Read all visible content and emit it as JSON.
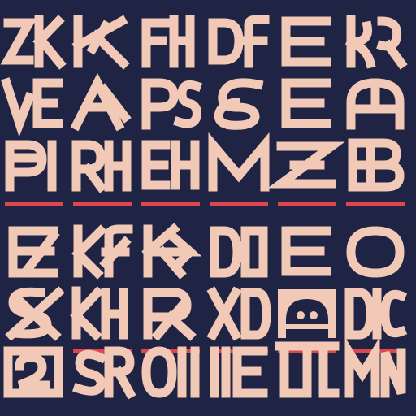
{
  "colors": {
    "background": "#1f2444",
    "glyph": "#f2c9b6",
    "rule": "#e0444d",
    "badge": "#f2c9b6",
    "badge_dark": "#1f2444"
  },
  "rows": [
    {
      "cells": [
        {
          "name": "glyph-z-k",
          "shape": "ZK"
        },
        {
          "name": "glyph-k-slash",
          "shape": "K2"
        },
        {
          "name": "glyph-f-bars",
          "shape": "FH"
        },
        {
          "name": "glyph-d-f",
          "shape": "DF"
        },
        {
          "name": "glyph-e",
          "shape": "E"
        },
        {
          "name": "glyph-k-curl",
          "shape": "KC"
        }
      ],
      "rule": false
    },
    {
      "cells": [
        {
          "name": "glyph-v-e",
          "shape": "VE"
        },
        {
          "name": "glyph-a-slash",
          "shape": "A2"
        },
        {
          "name": "glyph-p-s",
          "shape": "PS"
        },
        {
          "name": "glyph-s-loop",
          "shape": "SL"
        },
        {
          "name": "glyph-e-wide",
          "shape": "E"
        },
        {
          "name": "glyph-a-arch",
          "shape": "AH"
        }
      ],
      "rule": false
    },
    {
      "cells": [
        {
          "name": "glyph-p-i",
          "shape": "PI"
        },
        {
          "name": "glyph-r-h",
          "shape": "RH"
        },
        {
          "name": "glyph-e-split",
          "shape": "EH"
        },
        {
          "name": "glyph-m",
          "shape": "M"
        },
        {
          "name": "glyph-z-m",
          "shape": "ZM"
        },
        {
          "name": "glyph-b",
          "shape": "B"
        }
      ],
      "rule": true
    },
    {
      "cells": [
        {
          "name": "glyph-e-slash",
          "shape": "ES"
        },
        {
          "name": "glyph-k-f",
          "shape": "KF"
        },
        {
          "name": "glyph-k-arrow",
          "shape": "KA"
        },
        {
          "name": "glyph-d-o",
          "shape": "DO"
        },
        {
          "name": "glyph-e-round",
          "shape": "E"
        },
        {
          "name": "glyph-o",
          "shape": "O"
        }
      ],
      "rule": false
    },
    {
      "cells": [
        {
          "name": "glyph-s-cross",
          "shape": "SX"
        },
        {
          "name": "glyph-k-h",
          "shape": "KH"
        },
        {
          "name": "glyph-r-slash",
          "shape": "R2"
        },
        {
          "name": "glyph-x-o",
          "shape": "XO"
        },
        {
          "name": "glyph-b-badge",
          "shape": "BADGE"
        },
        {
          "name": "glyph-d-i-c",
          "shape": "DIC"
        }
      ],
      "rule": true
    },
    {
      "cells": [
        {
          "name": "glyph-a-box",
          "shape": "ABOX"
        },
        {
          "name": "glyph-s-r",
          "shape": "SR"
        },
        {
          "name": "glyph-o-i",
          "shape": "OI"
        },
        {
          "name": "glyph-i-e",
          "shape": "IE"
        },
        {
          "name": "glyph-ll-l",
          "shape": "LL"
        },
        {
          "name": "glyph-m-n",
          "shape": "MN"
        }
      ],
      "rule": false
    }
  ]
}
